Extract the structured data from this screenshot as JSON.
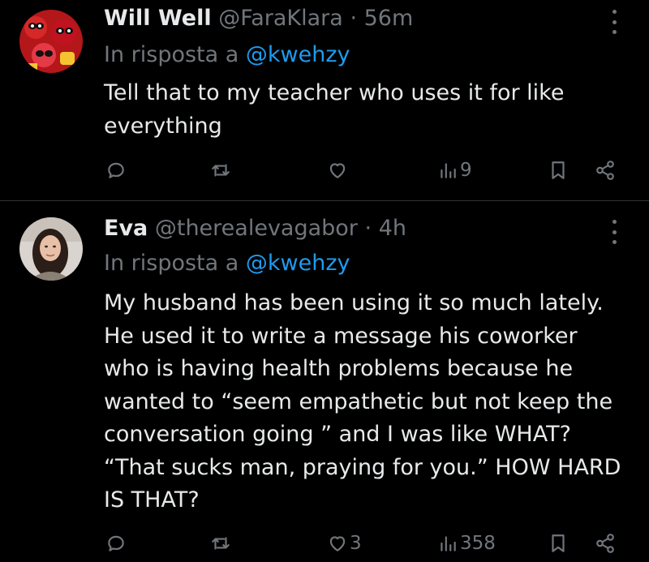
{
  "tweets": [
    {
      "name": "Will Well",
      "handle": "@FaraKlara",
      "separator": "·",
      "time": "56m",
      "reply_prefix": "In risposta a",
      "reply_to": "@kwehzy",
      "text": "Tell that to my teacher who uses it for like\neverything",
      "stats": {
        "likes": "",
        "views": "9"
      }
    },
    {
      "name": "Eva",
      "handle": "@therealevagabor",
      "separator": "·",
      "time": "4h",
      "reply_prefix": "In risposta a",
      "reply_to": "@kwehzy",
      "text": "My husband has been using it so much lately.\nHe used it to write a message his coworker\nwho is having health problems because he\nwanted to “seem empathetic but not keep the\nconversation going ” and I was like WHAT?\n“That sucks man, praying for you.” HOW HARD\nIS THAT?",
      "stats": {
        "likes": "3",
        "views": "358"
      }
    }
  ],
  "icons": {
    "reply": "reply-icon",
    "retweet": "retweet-icon",
    "like": "heart-icon",
    "views": "views-icon",
    "bookmark": "bookmark-icon",
    "share": "share-icon",
    "more": "more-icon"
  },
  "colors": {
    "background": "#000000",
    "text": "#e7e9ea",
    "muted": "#71767b",
    "link": "#1d9bf0",
    "divider": "#2f3336"
  }
}
